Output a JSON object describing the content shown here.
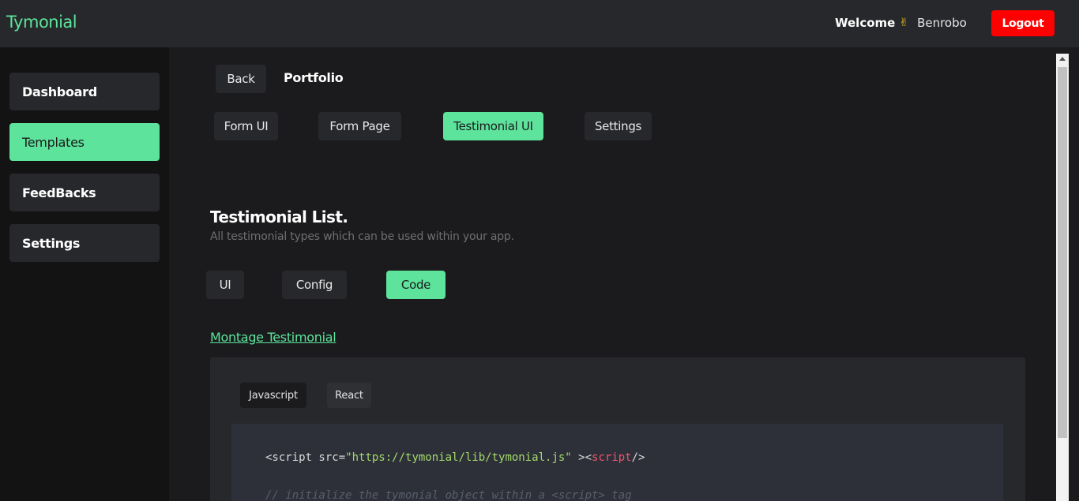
{
  "header": {
    "brand": "Tymonial",
    "welcome": "Welcome",
    "hand_emoji": "✌",
    "username": "Benrobo",
    "logout_label": "Logout"
  },
  "sidebar": {
    "items": [
      {
        "label": "Dashboard",
        "active": false
      },
      {
        "label": "Templates",
        "active": true
      },
      {
        "label": "FeedBacks",
        "active": false
      },
      {
        "label": "Settings",
        "active": false
      }
    ]
  },
  "breadcrumb": {
    "back_label": "Back",
    "current": "Portfolio"
  },
  "tabs": [
    {
      "label": "Form UI",
      "active": false
    },
    {
      "label": "Form Page",
      "active": false
    },
    {
      "label": "Testimonial UI",
      "active": true
    },
    {
      "label": "Settings",
      "active": false
    }
  ],
  "testimonial_list": {
    "title": "Testimonial List.",
    "subtitle": "All testimonial types which can be used within your app."
  },
  "sub_tabs": [
    {
      "label": "UI",
      "active": false
    },
    {
      "label": "Config",
      "active": false
    },
    {
      "label": "Code",
      "active": true
    }
  ],
  "montage": {
    "link_label": "Montage Testimonial",
    "languages": [
      {
        "label": "Javascript",
        "active": true
      },
      {
        "label": "React",
        "active": false
      }
    ],
    "code": {
      "line1_open": "<script src=",
      "line1_src": "\"https://tymonial/lib/tymonial.js\"",
      "line1_mid": " ><",
      "line1_tag": "script",
      "line1_close": "/>",
      "line2_comment": "// initialize the tymonial object within a <script> tag"
    }
  },
  "colors": {
    "accent": "#5de39b",
    "danger": "#ff0000",
    "surface": "#27282b",
    "background": "#1b1b1d",
    "sidebar": "#131314"
  }
}
